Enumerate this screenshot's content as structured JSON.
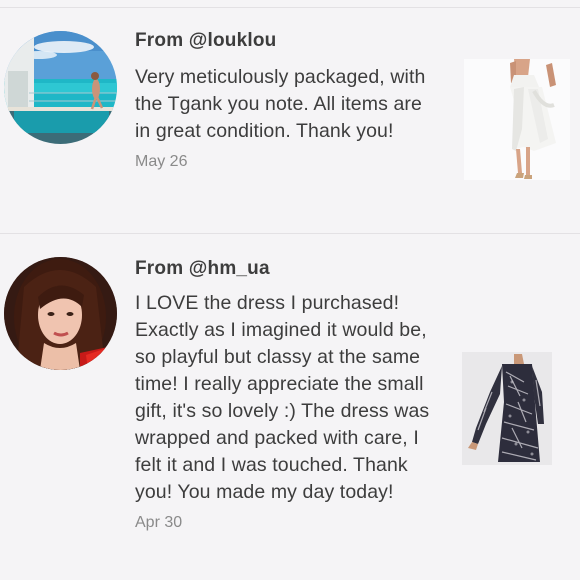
{
  "reviews": [
    {
      "from_prefix": "From ",
      "handle": "@louklou",
      "message": "Very meticulously packaged, with the Tgank you note. All items are in great condition. Thank you!",
      "date": "May 26"
    },
    {
      "from_prefix": "From ",
      "handle": "@hm_ua",
      "message": "I LOVE the dress I purchased! Exactly as I imagined it would be, so playful but classy at the same time! I really appreciate the small gift, it's so lovely :) The dress was wrapped and packed with care, I felt it and I was touched. Thank you! You made my day today!",
      "date": "Apr 30"
    }
  ],
  "colors": {
    "background": "#f5f4f6",
    "text": "#3d3d3d",
    "date": "#8a8a8a",
    "divider": "#e3e1e4"
  }
}
